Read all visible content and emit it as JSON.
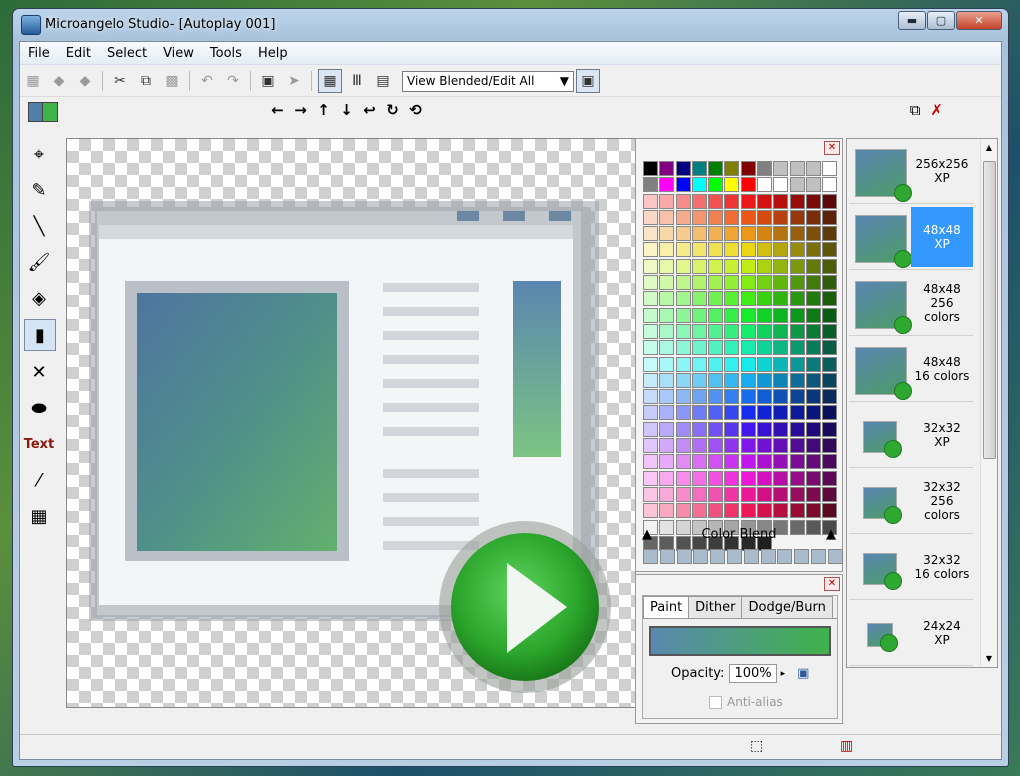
{
  "window": {
    "title": "Microangelo Studio- [Autoplay 001]",
    "buttons": {
      "minimize": "▬",
      "maximize": "▢",
      "close": "✕"
    }
  },
  "menu": [
    "File",
    "Edit",
    "Select",
    "View",
    "Tools",
    "Help"
  ],
  "toolbar": {
    "view_mode": "View Blended/Edit All",
    "dropdown_arrow": "▼"
  },
  "arrows": [
    "←",
    "→",
    "↑",
    "↓",
    "↩",
    "↻",
    "⟲"
  ],
  "palette": {
    "close": "✕",
    "blend_label": "Color Blend",
    "expand": "▼"
  },
  "paint_panel": {
    "close": "✕",
    "tabs": [
      "Paint",
      "Dither",
      "Dodge/Burn"
    ],
    "opacity_label": "Opacity:",
    "opacity_value": "100%",
    "antialias_label": "Anti-alias"
  },
  "sizes": [
    {
      "line1": "256x256",
      "line2": "XP"
    },
    {
      "line1": "48x48",
      "line2": "XP"
    },
    {
      "line1": "48x48",
      "line2": "256 colors"
    },
    {
      "line1": "48x48",
      "line2": "16 colors"
    },
    {
      "line1": "32x32",
      "line2": "XP"
    },
    {
      "line1": "32x32",
      "line2": "256 colors"
    },
    {
      "line1": "32x32",
      "line2": "16 colors"
    },
    {
      "line1": "24x24",
      "line2": "XP"
    }
  ],
  "colors": {
    "accent": "#3399ff",
    "play": "#2fa832"
  }
}
